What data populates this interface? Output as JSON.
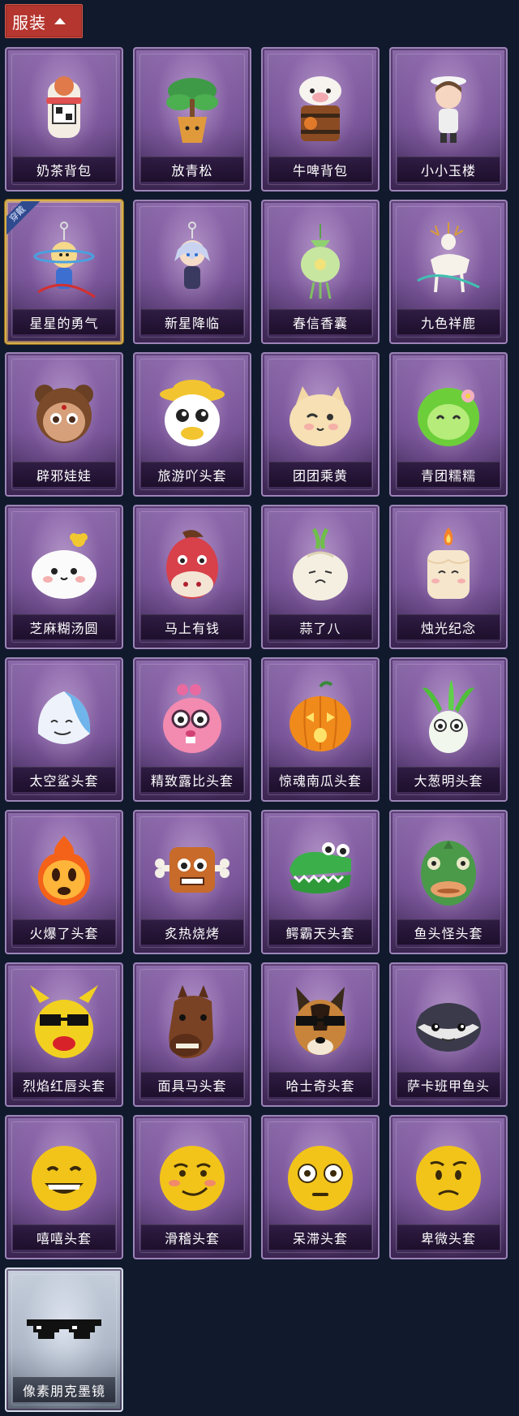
{
  "header": {
    "label": "服装"
  },
  "items": [
    {
      "name": "奶茶背包",
      "icon": "milk-tea-backpack-icon",
      "equipped": false,
      "style": "purple"
    },
    {
      "name": "放青松",
      "icon": "potted-pine-icon",
      "equipped": false,
      "style": "purple"
    },
    {
      "name": "牛啤背包",
      "icon": "cow-barrel-backpack-icon",
      "equipped": false,
      "style": "purple"
    },
    {
      "name": "小小玉楼",
      "icon": "chibi-figure-icon",
      "equipped": false,
      "style": "purple"
    },
    {
      "name": "星星的勇气",
      "icon": "star-keychain-icon",
      "equipped": true,
      "equipped_label": "穿戴",
      "style": "purple"
    },
    {
      "name": "新星降临",
      "icon": "nova-keychain-icon",
      "equipped": false,
      "style": "purple"
    },
    {
      "name": "春信香囊",
      "icon": "sachet-icon",
      "equipped": false,
      "style": "purple"
    },
    {
      "name": "九色祥鹿",
      "icon": "deer-charm-icon",
      "equipped": false,
      "style": "purple"
    },
    {
      "name": "辟邪娃娃",
      "icon": "doll-head-icon",
      "equipped": false,
      "style": "purple"
    },
    {
      "name": "旅游吖头套",
      "icon": "duck-hat-head-icon",
      "equipped": false,
      "style": "purple"
    },
    {
      "name": "团团乘黄",
      "icon": "round-cat-icon",
      "equipped": false,
      "style": "purple"
    },
    {
      "name": "青团糯糯",
      "icon": "green-dumpling-icon",
      "equipped": false,
      "style": "purple"
    },
    {
      "name": "芝麻糊汤圆",
      "icon": "rice-ball-icon",
      "equipped": false,
      "style": "purple"
    },
    {
      "name": "马上有钱",
      "icon": "red-horse-icon",
      "equipped": false,
      "style": "purple"
    },
    {
      "name": "蒜了八",
      "icon": "garlic-icon",
      "equipped": false,
      "style": "purple"
    },
    {
      "name": "烛光纪念",
      "icon": "candle-icon",
      "equipped": false,
      "style": "purple"
    },
    {
      "name": "太空鲨头套",
      "icon": "shark-head-icon",
      "equipped": false,
      "style": "purple"
    },
    {
      "name": "精致露比头套",
      "icon": "pink-beaver-head-icon",
      "equipped": false,
      "style": "purple"
    },
    {
      "name": "惊魂南瓜头套",
      "icon": "pumpkin-head-icon",
      "equipped": false,
      "style": "purple"
    },
    {
      "name": "大葱明头套",
      "icon": "scallion-head-icon",
      "equipped": false,
      "style": "purple"
    },
    {
      "name": "火爆了头套",
      "icon": "fire-head-icon",
      "equipped": false,
      "style": "purple"
    },
    {
      "name": "炙热烧烤",
      "icon": "meat-bone-icon",
      "equipped": false,
      "style": "purple"
    },
    {
      "name": "鳄霸天头套",
      "icon": "crocodile-head-icon",
      "equipped": false,
      "style": "purple"
    },
    {
      "name": "鱼头怪头套",
      "icon": "fish-head-icon",
      "equipped": false,
      "style": "purple"
    },
    {
      "name": "烈焰红唇头套",
      "icon": "yellow-pika-head-icon",
      "equipped": false,
      "style": "purple"
    },
    {
      "name": "面具马头套",
      "icon": "horse-mask-icon",
      "equipped": false,
      "style": "purple"
    },
    {
      "name": "哈士奇头套",
      "icon": "dog-head-icon",
      "equipped": false,
      "style": "purple"
    },
    {
      "name": "萨卡班甲鱼头",
      "icon": "armored-fish-head-icon",
      "equipped": false,
      "style": "purple"
    },
    {
      "name": "嘻嘻头套",
      "icon": "grin-emoji-icon",
      "equipped": false,
      "style": "purple"
    },
    {
      "name": "滑稽头套",
      "icon": "smirk-emoji-icon",
      "equipped": false,
      "style": "purple"
    },
    {
      "name": "呆滞头套",
      "icon": "stare-emoji-icon",
      "equipped": false,
      "style": "purple"
    },
    {
      "name": "卑微头套",
      "icon": "timid-emoji-icon",
      "equipped": false,
      "style": "purple"
    },
    {
      "name": "像素朋克墨镜",
      "icon": "pixel-sunglasses-icon",
      "equipped": false,
      "style": "silver"
    }
  ]
}
